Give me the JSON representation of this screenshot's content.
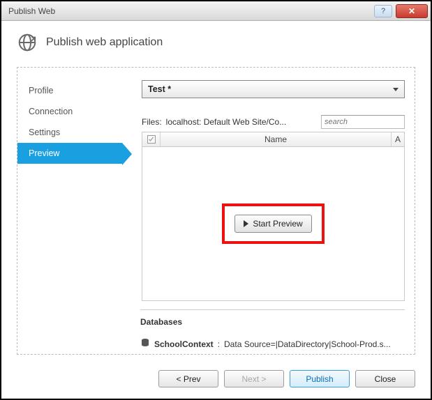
{
  "titlebar": {
    "title": "Publish Web"
  },
  "header": {
    "title": "Publish web application"
  },
  "nav": {
    "items": [
      {
        "label": "Profile"
      },
      {
        "label": "Connection"
      },
      {
        "label": "Settings"
      },
      {
        "label": "Preview"
      }
    ],
    "selected_index": 3
  },
  "profile": {
    "selected": "Test *"
  },
  "files": {
    "label": "Files:",
    "path": "localhost: Default Web Site/Co...",
    "search_placeholder": "search"
  },
  "grid": {
    "columns": {
      "name": "Name",
      "a": "A"
    }
  },
  "preview": {
    "start_label": "Start Preview"
  },
  "databases": {
    "heading": "Databases",
    "items": [
      {
        "context": "SchoolContext",
        "connection": "Data Source=|DataDirectory|School-Prod.s..."
      }
    ]
  },
  "buttons": {
    "prev": "< Prev",
    "next": "Next >",
    "publish": "Publish",
    "close": "Close"
  }
}
